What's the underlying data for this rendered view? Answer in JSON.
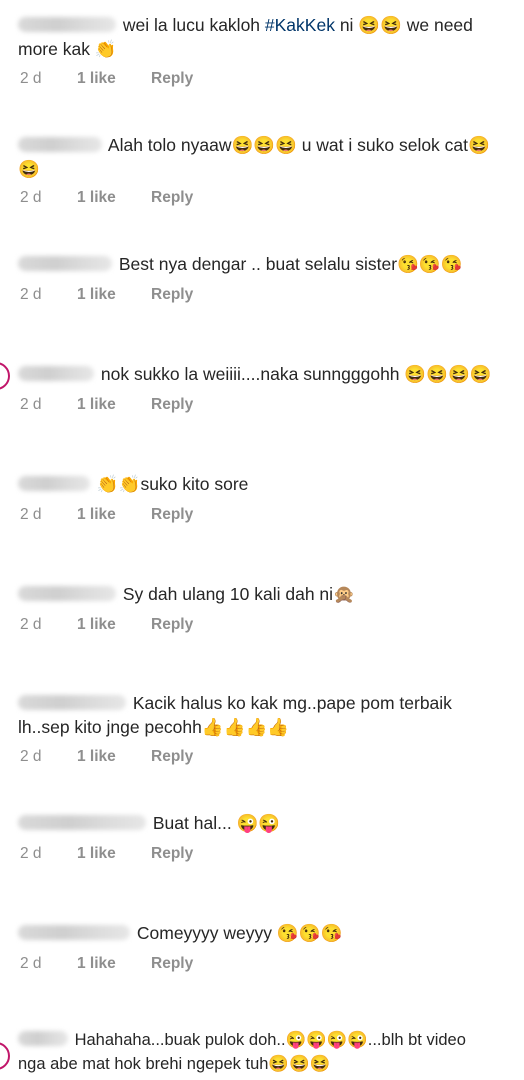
{
  "comments": [
    {
      "line1_a": "wei la lucu kakloh ",
      "hashtag": "#KakKek",
      "line1_b": " ni 😆😆 we need",
      "line2": "more kak 👏",
      "age": "2 d",
      "likes": "1 like",
      "reply": "Reply"
    },
    {
      "line1": "Alah tolo nyaaw😆😆😆 u wat i suko selok cat😆",
      "line2": "😆",
      "age": "2 d",
      "likes": "1 like",
      "reply": "Reply"
    },
    {
      "line1": "Best nya dengar .. buat selalu sister😘😘😘",
      "age": "2 d",
      "likes": "1 like",
      "reply": "Reply"
    },
    {
      "line1": "nok sukko la weiiii....naka sunngggohh 😆😆😆😆",
      "age": "2 d",
      "likes": "1 like",
      "reply": "Reply"
    },
    {
      "line1": "👏👏suko kito sore",
      "age": "2 d",
      "likes": "1 like",
      "reply": "Reply"
    },
    {
      "line1": "Sy dah ulang 10 kali dah ni🙊",
      "age": "2 d",
      "likes": "1 like",
      "reply": "Reply"
    },
    {
      "line1": "Kacik halus ko kak mg..pape pom terbaik",
      "line2": "lh..sep kito jnge pecohh👍👍👍👍",
      "age": "2 d",
      "likes": "1 like",
      "reply": "Reply"
    },
    {
      "line1": "Buat hal... 😜😜",
      "age": "2 d",
      "likes": "1 like",
      "reply": "Reply"
    },
    {
      "line1": "Comeyyyy weyyy 😘😘😘",
      "age": "2 d",
      "likes": "1 like",
      "reply": "Reply"
    },
    {
      "line1": "Hahahaha...buak pulok doh..😜😜😜😜...blh bt video",
      "line2": "nga abe mat hok brehi ngepek tuh😆😆😆"
    }
  ]
}
